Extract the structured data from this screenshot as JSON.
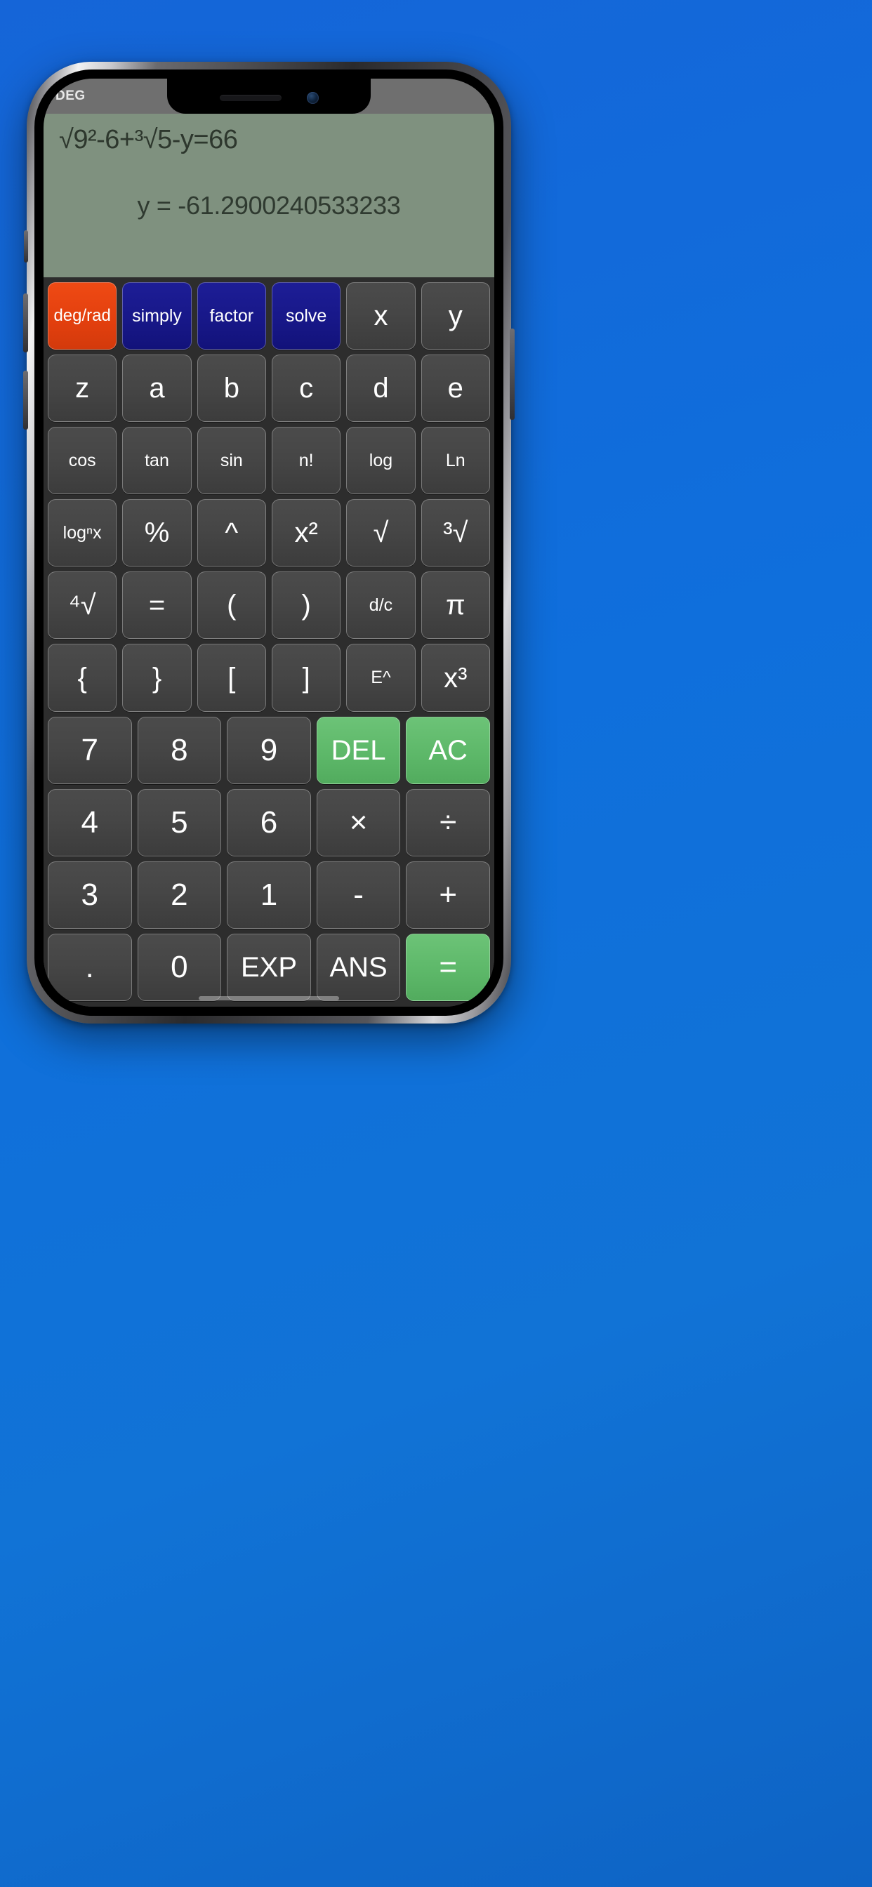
{
  "app": {
    "name": "scientific-calculator",
    "angle_mode": "DEG"
  },
  "display": {
    "expression": "√9²-6+³√5-y=66",
    "result": "y = -61.2900240533233"
  },
  "colors": {
    "background": "#1068D4",
    "screen_bg": "#2d2d2d",
    "status_bar": "#6f6f6f",
    "display_bg": "#7f917f",
    "display_text": "#2d372d",
    "key_default": "#464646",
    "key_orange": "#e23f0e",
    "key_blue": "#171787",
    "key_green": "#5cb768",
    "key_text": "#ffffff"
  },
  "keypad": {
    "rows": [
      [
        {
          "label": "deg/rad",
          "name": "key-deg-rad",
          "style": "orange",
          "size": "small-text"
        },
        {
          "label": "simply",
          "name": "key-simply",
          "style": "blue",
          "size": "fn"
        },
        {
          "label": "factor",
          "name": "key-factor",
          "style": "blue",
          "size": "fn"
        },
        {
          "label": "solve",
          "name": "key-solve",
          "style": "blue",
          "size": "fn"
        },
        {
          "label": "x",
          "name": "key-var-x",
          "style": "",
          "size": "op"
        },
        {
          "label": "y",
          "name": "key-var-y",
          "style": "",
          "size": "op"
        }
      ],
      [
        {
          "label": "z",
          "name": "key-var-z",
          "style": "",
          "size": "op"
        },
        {
          "label": "a",
          "name": "key-var-a",
          "style": "",
          "size": "op"
        },
        {
          "label": "b",
          "name": "key-var-b",
          "style": "",
          "size": "op"
        },
        {
          "label": "c",
          "name": "key-var-c",
          "style": "",
          "size": "op"
        },
        {
          "label": "d",
          "name": "key-var-d",
          "style": "",
          "size": "op"
        },
        {
          "label": "e",
          "name": "key-var-e",
          "style": "",
          "size": "op"
        }
      ],
      [
        {
          "label": "cos",
          "name": "key-cos",
          "style": "",
          "size": "fn"
        },
        {
          "label": "tan",
          "name": "key-tan",
          "style": "",
          "size": "fn"
        },
        {
          "label": "sin",
          "name": "key-sin",
          "style": "",
          "size": "fn"
        },
        {
          "label": "n!",
          "name": "key-factorial",
          "style": "",
          "size": "fn"
        },
        {
          "label": "log",
          "name": "key-log",
          "style": "",
          "size": "fn"
        },
        {
          "label": "Ln",
          "name": "key-ln",
          "style": "",
          "size": "fn"
        }
      ],
      [
        {
          "label": "logⁿx",
          "name": "key-log-n-x",
          "style": "",
          "size": "fn"
        },
        {
          "label": "%",
          "name": "key-percent",
          "style": "",
          "size": "op"
        },
        {
          "label": "^",
          "name": "key-power",
          "style": "",
          "size": "op"
        },
        {
          "label": "x²",
          "name": "key-x-squared",
          "style": "",
          "size": "op"
        },
        {
          "label": "√",
          "name": "key-square-root",
          "style": "",
          "size": "op"
        },
        {
          "label": "³√",
          "name": "key-cube-root",
          "style": "",
          "size": "op"
        }
      ],
      [
        {
          "label": "⁴√",
          "name": "key-fourth-root",
          "style": "",
          "size": "op"
        },
        {
          "label": "=",
          "name": "key-equals-insert",
          "style": "",
          "size": "op"
        },
        {
          "label": "(",
          "name": "key-paren-open",
          "style": "",
          "size": "op"
        },
        {
          "label": ")",
          "name": "key-paren-close",
          "style": "",
          "size": "op"
        },
        {
          "label": "d/c",
          "name": "key-decimal-fraction",
          "style": "",
          "size": "fn"
        },
        {
          "label": "π",
          "name": "key-pi",
          "style": "",
          "size": "op"
        }
      ],
      [
        {
          "label": "{",
          "name": "key-brace-open",
          "style": "",
          "size": "op"
        },
        {
          "label": "}",
          "name": "key-brace-close",
          "style": "",
          "size": "op"
        },
        {
          "label": "[",
          "name": "key-bracket-open",
          "style": "",
          "size": "op"
        },
        {
          "label": "]",
          "name": "key-bracket-close",
          "style": "",
          "size": "op"
        },
        {
          "label": "E^",
          "name": "key-e-power",
          "style": "",
          "size": "fn"
        },
        {
          "label": "x³",
          "name": "key-x-cubed",
          "style": "",
          "size": "op"
        }
      ],
      [
        {
          "label": "7",
          "name": "key-7",
          "style": "",
          "size": "num"
        },
        {
          "label": "8",
          "name": "key-8",
          "style": "",
          "size": "num"
        },
        {
          "label": "9",
          "name": "key-9",
          "style": "",
          "size": "num"
        },
        {
          "label": "DEL",
          "name": "key-del",
          "style": "green",
          "size": "op"
        },
        {
          "label": "AC",
          "name": "key-ac",
          "style": "green",
          "size": "op"
        }
      ],
      [
        {
          "label": "4",
          "name": "key-4",
          "style": "",
          "size": "num"
        },
        {
          "label": "5",
          "name": "key-5",
          "style": "",
          "size": "num"
        },
        {
          "label": "6",
          "name": "key-6",
          "style": "",
          "size": "num"
        },
        {
          "label": "×",
          "name": "key-multiply",
          "style": "",
          "size": "num"
        },
        {
          "label": "÷",
          "name": "key-divide",
          "style": "",
          "size": "num"
        }
      ],
      [
        {
          "label": "3",
          "name": "key-3",
          "style": "",
          "size": "num"
        },
        {
          "label": "2",
          "name": "key-2",
          "style": "",
          "size": "num"
        },
        {
          "label": "1",
          "name": "key-1",
          "style": "",
          "size": "num"
        },
        {
          "label": "-",
          "name": "key-minus",
          "style": "",
          "size": "num"
        },
        {
          "label": "+",
          "name": "key-plus",
          "style": "",
          "size": "num"
        }
      ],
      [
        {
          "label": ".",
          "name": "key-decimal-point",
          "style": "",
          "size": "num"
        },
        {
          "label": "0",
          "name": "key-0",
          "style": "",
          "size": "num"
        },
        {
          "label": "EXP",
          "name": "key-exp",
          "style": "",
          "size": "op"
        },
        {
          "label": "ANS",
          "name": "key-ans",
          "style": "",
          "size": "op"
        },
        {
          "label": "=",
          "name": "key-equals",
          "style": "green",
          "size": "num"
        }
      ]
    ]
  }
}
